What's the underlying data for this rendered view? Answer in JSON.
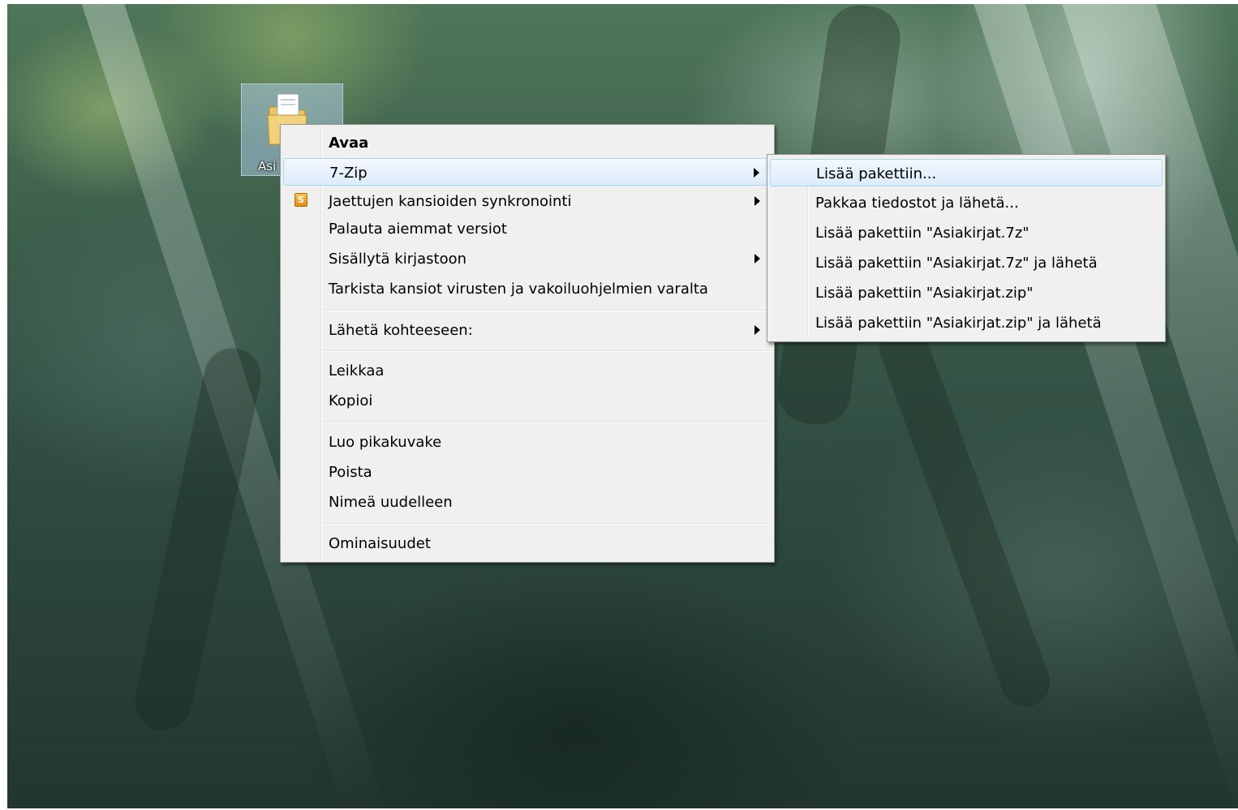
{
  "desktop": {
    "icon_label": "Asi"
  },
  "context_menu": {
    "items": [
      {
        "label": "Avaa",
        "bold": true
      },
      {
        "label": "7-Zip",
        "submenu": true,
        "highlighted": true
      },
      {
        "label": "Jaettujen kansioiden synkronointi",
        "submenu": true,
        "icon": "S"
      },
      {
        "label": "Palauta aiemmat versiot"
      },
      {
        "label": "Sisällytä kirjastoon",
        "submenu": true
      },
      {
        "label": "Tarkista kansiot virusten ja vakoiluohjelmien varalta"
      },
      {
        "label": "Lähetä kohteeseen:",
        "submenu": true
      },
      {
        "label": "Leikkaa"
      },
      {
        "label": "Kopioi"
      },
      {
        "label": "Luo pikakuvake"
      },
      {
        "label": "Poista"
      },
      {
        "label": "Nimeä uudelleen"
      },
      {
        "label": "Ominaisuudet"
      }
    ]
  },
  "submenu_7zip": {
    "items": [
      {
        "label": "Lisää pakettiin...",
        "highlighted": true
      },
      {
        "label": "Pakkaa tiedostot ja lähetä..."
      },
      {
        "label": "Lisää pakettiin \"Asiakirjat.7z\""
      },
      {
        "label": "Lisää pakettiin \"Asiakirjat.7z\" ja lähetä"
      },
      {
        "label": "Lisää pakettiin \"Asiakirjat.zip\""
      },
      {
        "label": "Lisää pakettiin \"Asiakirjat.zip\" ja lähetä"
      }
    ]
  },
  "colors": {
    "menu_bg": "#f0f0f0",
    "highlight_border": "#a8d8f0",
    "highlight_bg": "#dcebfb"
  }
}
